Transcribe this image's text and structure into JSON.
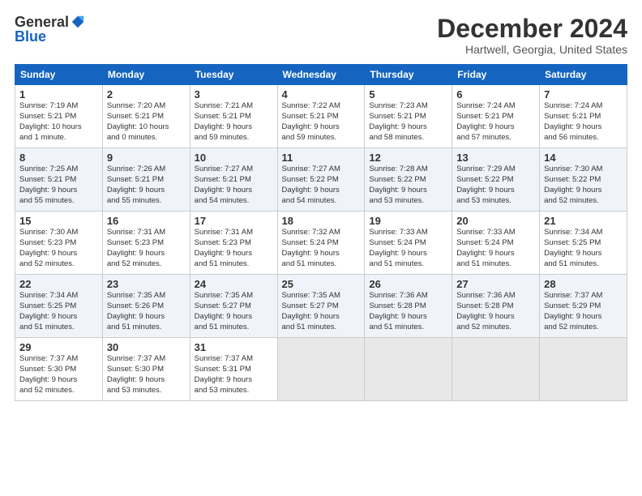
{
  "header": {
    "logo_general": "General",
    "logo_blue": "Blue",
    "title": "December 2024",
    "subtitle": "Hartwell, Georgia, United States"
  },
  "columns": [
    "Sunday",
    "Monday",
    "Tuesday",
    "Wednesday",
    "Thursday",
    "Friday",
    "Saturday"
  ],
  "weeks": [
    [
      {
        "day": "1",
        "info": "Sunrise: 7:19 AM\nSunset: 5:21 PM\nDaylight: 10 hours\nand 1 minute."
      },
      {
        "day": "2",
        "info": "Sunrise: 7:20 AM\nSunset: 5:21 PM\nDaylight: 10 hours\nand 0 minutes."
      },
      {
        "day": "3",
        "info": "Sunrise: 7:21 AM\nSunset: 5:21 PM\nDaylight: 9 hours\nand 59 minutes."
      },
      {
        "day": "4",
        "info": "Sunrise: 7:22 AM\nSunset: 5:21 PM\nDaylight: 9 hours\nand 59 minutes."
      },
      {
        "day": "5",
        "info": "Sunrise: 7:23 AM\nSunset: 5:21 PM\nDaylight: 9 hours\nand 58 minutes."
      },
      {
        "day": "6",
        "info": "Sunrise: 7:24 AM\nSunset: 5:21 PM\nDaylight: 9 hours\nand 57 minutes."
      },
      {
        "day": "7",
        "info": "Sunrise: 7:24 AM\nSunset: 5:21 PM\nDaylight: 9 hours\nand 56 minutes."
      }
    ],
    [
      {
        "day": "8",
        "info": "Sunrise: 7:25 AM\nSunset: 5:21 PM\nDaylight: 9 hours\nand 55 minutes."
      },
      {
        "day": "9",
        "info": "Sunrise: 7:26 AM\nSunset: 5:21 PM\nDaylight: 9 hours\nand 55 minutes."
      },
      {
        "day": "10",
        "info": "Sunrise: 7:27 AM\nSunset: 5:21 PM\nDaylight: 9 hours\nand 54 minutes."
      },
      {
        "day": "11",
        "info": "Sunrise: 7:27 AM\nSunset: 5:22 PM\nDaylight: 9 hours\nand 54 minutes."
      },
      {
        "day": "12",
        "info": "Sunrise: 7:28 AM\nSunset: 5:22 PM\nDaylight: 9 hours\nand 53 minutes."
      },
      {
        "day": "13",
        "info": "Sunrise: 7:29 AM\nSunset: 5:22 PM\nDaylight: 9 hours\nand 53 minutes."
      },
      {
        "day": "14",
        "info": "Sunrise: 7:30 AM\nSunset: 5:22 PM\nDaylight: 9 hours\nand 52 minutes."
      }
    ],
    [
      {
        "day": "15",
        "info": "Sunrise: 7:30 AM\nSunset: 5:23 PM\nDaylight: 9 hours\nand 52 minutes."
      },
      {
        "day": "16",
        "info": "Sunrise: 7:31 AM\nSunset: 5:23 PM\nDaylight: 9 hours\nand 52 minutes."
      },
      {
        "day": "17",
        "info": "Sunrise: 7:31 AM\nSunset: 5:23 PM\nDaylight: 9 hours\nand 51 minutes."
      },
      {
        "day": "18",
        "info": "Sunrise: 7:32 AM\nSunset: 5:24 PM\nDaylight: 9 hours\nand 51 minutes."
      },
      {
        "day": "19",
        "info": "Sunrise: 7:33 AM\nSunset: 5:24 PM\nDaylight: 9 hours\nand 51 minutes."
      },
      {
        "day": "20",
        "info": "Sunrise: 7:33 AM\nSunset: 5:24 PM\nDaylight: 9 hours\nand 51 minutes."
      },
      {
        "day": "21",
        "info": "Sunrise: 7:34 AM\nSunset: 5:25 PM\nDaylight: 9 hours\nand 51 minutes."
      }
    ],
    [
      {
        "day": "22",
        "info": "Sunrise: 7:34 AM\nSunset: 5:25 PM\nDaylight: 9 hours\nand 51 minutes."
      },
      {
        "day": "23",
        "info": "Sunrise: 7:35 AM\nSunset: 5:26 PM\nDaylight: 9 hours\nand 51 minutes."
      },
      {
        "day": "24",
        "info": "Sunrise: 7:35 AM\nSunset: 5:27 PM\nDaylight: 9 hours\nand 51 minutes."
      },
      {
        "day": "25",
        "info": "Sunrise: 7:35 AM\nSunset: 5:27 PM\nDaylight: 9 hours\nand 51 minutes."
      },
      {
        "day": "26",
        "info": "Sunrise: 7:36 AM\nSunset: 5:28 PM\nDaylight: 9 hours\nand 51 minutes."
      },
      {
        "day": "27",
        "info": "Sunrise: 7:36 AM\nSunset: 5:28 PM\nDaylight: 9 hours\nand 52 minutes."
      },
      {
        "day": "28",
        "info": "Sunrise: 7:37 AM\nSunset: 5:29 PM\nDaylight: 9 hours\nand 52 minutes."
      }
    ],
    [
      {
        "day": "29",
        "info": "Sunrise: 7:37 AM\nSunset: 5:30 PM\nDaylight: 9 hours\nand 52 minutes."
      },
      {
        "day": "30",
        "info": "Sunrise: 7:37 AM\nSunset: 5:30 PM\nDaylight: 9 hours\nand 53 minutes."
      },
      {
        "day": "31",
        "info": "Sunrise: 7:37 AM\nSunset: 5:31 PM\nDaylight: 9 hours\nand 53 minutes."
      },
      {
        "day": "",
        "info": ""
      },
      {
        "day": "",
        "info": ""
      },
      {
        "day": "",
        "info": ""
      },
      {
        "day": "",
        "info": ""
      }
    ]
  ]
}
